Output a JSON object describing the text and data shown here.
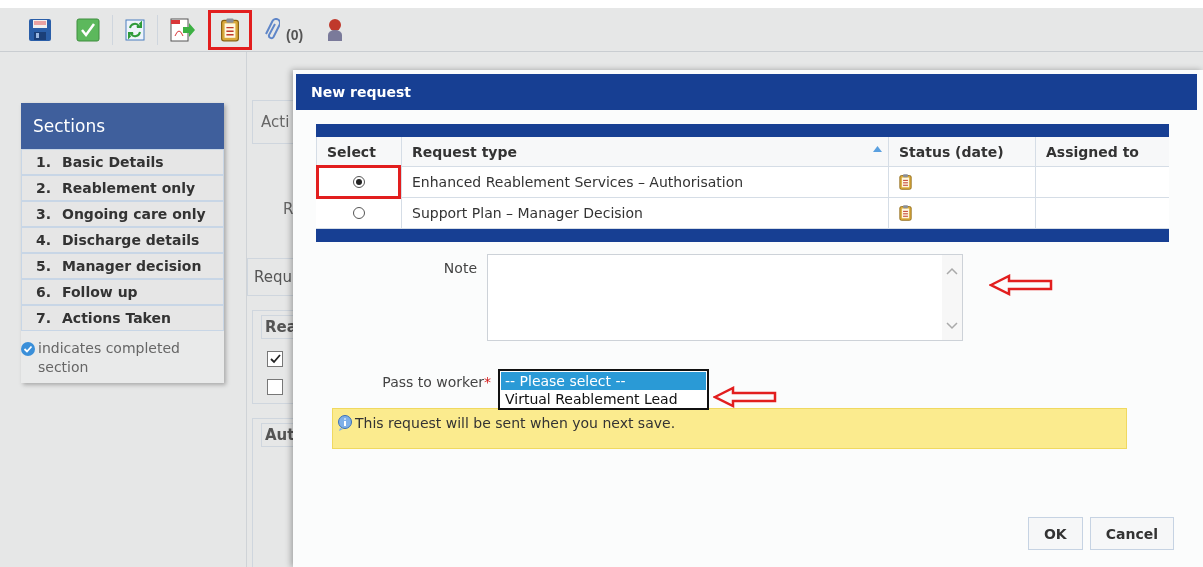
{
  "toolbar": {
    "buttons": [
      {
        "kind": "save",
        "highlighted": false
      },
      {
        "kind": "complete",
        "highlighted": false
      },
      {
        "kind": "refresh",
        "highlighted": false
      },
      {
        "kind": "pdf",
        "highlighted": false
      },
      {
        "kind": "requests",
        "highlighted": true
      },
      {
        "kind": "attachments",
        "highlighted": false,
        "count": "(0)"
      },
      {
        "kind": "person",
        "highlighted": false
      }
    ]
  },
  "sections": {
    "title": "Sections",
    "items": [
      {
        "number": "1.",
        "label": "Basic Details"
      },
      {
        "number": "2.",
        "label": "Reablement only"
      },
      {
        "number": "3.",
        "label": "Ongoing care only"
      },
      {
        "number": "4.",
        "label": "Discharge details"
      },
      {
        "number": "5.",
        "label": "Manager decision"
      },
      {
        "number": "6.",
        "label": "Follow up"
      },
      {
        "number": "7.",
        "label": "Actions Taken"
      }
    ],
    "legend": "indicates completed section"
  },
  "form": {
    "tab": "Acti",
    "field_label": "R",
    "panel": "Requ",
    "group_1": {
      "legend": "Rea",
      "checkboxes": [
        {
          "checked": true
        },
        {
          "checked": false
        }
      ]
    },
    "group_2": {
      "legend": "Aut"
    }
  },
  "dialog": {
    "title": "New request",
    "table": {
      "columns": [
        {
          "label": "Select",
          "sorted": false
        },
        {
          "label": "Request type",
          "sorted": true
        },
        {
          "label": "Status (date)",
          "sorted": false
        },
        {
          "label": "Assigned to",
          "sorted": false
        }
      ],
      "rows": [
        {
          "selected": true,
          "highlighted": true,
          "request_type": "Enhanced Reablement Services – Authorisation"
        },
        {
          "selected": false,
          "highlighted": false,
          "request_type": "Support Plan – Manager Decision"
        }
      ]
    },
    "note": {
      "label": "Note"
    },
    "pass_to_worker": {
      "label": "Pass to worker",
      "required_mark": "*",
      "options": [
        {
          "label": "-- Please select --",
          "selected": true
        },
        {
          "label": "Virtual Reablement Lead",
          "selected": false
        }
      ]
    },
    "info": "This request will be sent when you next save.",
    "buttons": [
      "OK",
      "Cancel"
    ]
  }
}
